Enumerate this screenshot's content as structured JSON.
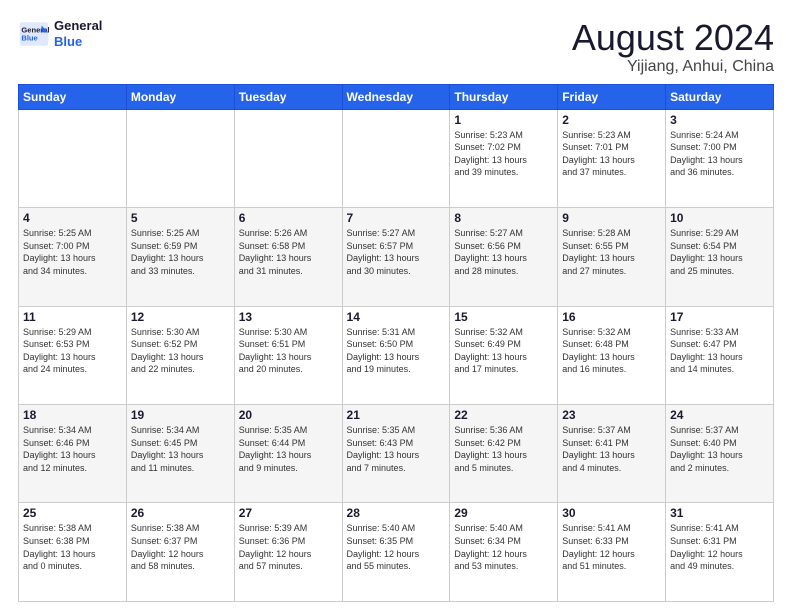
{
  "header": {
    "logo_line1": "General",
    "logo_line2": "Blue",
    "main_title": "August 2024",
    "subtitle": "Yijiang, Anhui, China"
  },
  "days_of_week": [
    "Sunday",
    "Monday",
    "Tuesday",
    "Wednesday",
    "Thursday",
    "Friday",
    "Saturday"
  ],
  "weeks": [
    [
      {
        "day": "",
        "info": ""
      },
      {
        "day": "",
        "info": ""
      },
      {
        "day": "",
        "info": ""
      },
      {
        "day": "",
        "info": ""
      },
      {
        "day": "1",
        "info": "Sunrise: 5:23 AM\nSunset: 7:02 PM\nDaylight: 13 hours\nand 39 minutes."
      },
      {
        "day": "2",
        "info": "Sunrise: 5:23 AM\nSunset: 7:01 PM\nDaylight: 13 hours\nand 37 minutes."
      },
      {
        "day": "3",
        "info": "Sunrise: 5:24 AM\nSunset: 7:00 PM\nDaylight: 13 hours\nand 36 minutes."
      }
    ],
    [
      {
        "day": "4",
        "info": "Sunrise: 5:25 AM\nSunset: 7:00 PM\nDaylight: 13 hours\nand 34 minutes."
      },
      {
        "day": "5",
        "info": "Sunrise: 5:25 AM\nSunset: 6:59 PM\nDaylight: 13 hours\nand 33 minutes."
      },
      {
        "day": "6",
        "info": "Sunrise: 5:26 AM\nSunset: 6:58 PM\nDaylight: 13 hours\nand 31 minutes."
      },
      {
        "day": "7",
        "info": "Sunrise: 5:27 AM\nSunset: 6:57 PM\nDaylight: 13 hours\nand 30 minutes."
      },
      {
        "day": "8",
        "info": "Sunrise: 5:27 AM\nSunset: 6:56 PM\nDaylight: 13 hours\nand 28 minutes."
      },
      {
        "day": "9",
        "info": "Sunrise: 5:28 AM\nSunset: 6:55 PM\nDaylight: 13 hours\nand 27 minutes."
      },
      {
        "day": "10",
        "info": "Sunrise: 5:29 AM\nSunset: 6:54 PM\nDaylight: 13 hours\nand 25 minutes."
      }
    ],
    [
      {
        "day": "11",
        "info": "Sunrise: 5:29 AM\nSunset: 6:53 PM\nDaylight: 13 hours\nand 24 minutes."
      },
      {
        "day": "12",
        "info": "Sunrise: 5:30 AM\nSunset: 6:52 PM\nDaylight: 13 hours\nand 22 minutes."
      },
      {
        "day": "13",
        "info": "Sunrise: 5:30 AM\nSunset: 6:51 PM\nDaylight: 13 hours\nand 20 minutes."
      },
      {
        "day": "14",
        "info": "Sunrise: 5:31 AM\nSunset: 6:50 PM\nDaylight: 13 hours\nand 19 minutes."
      },
      {
        "day": "15",
        "info": "Sunrise: 5:32 AM\nSunset: 6:49 PM\nDaylight: 13 hours\nand 17 minutes."
      },
      {
        "day": "16",
        "info": "Sunrise: 5:32 AM\nSunset: 6:48 PM\nDaylight: 13 hours\nand 16 minutes."
      },
      {
        "day": "17",
        "info": "Sunrise: 5:33 AM\nSunset: 6:47 PM\nDaylight: 13 hours\nand 14 minutes."
      }
    ],
    [
      {
        "day": "18",
        "info": "Sunrise: 5:34 AM\nSunset: 6:46 PM\nDaylight: 13 hours\nand 12 minutes."
      },
      {
        "day": "19",
        "info": "Sunrise: 5:34 AM\nSunset: 6:45 PM\nDaylight: 13 hours\nand 11 minutes."
      },
      {
        "day": "20",
        "info": "Sunrise: 5:35 AM\nSunset: 6:44 PM\nDaylight: 13 hours\nand 9 minutes."
      },
      {
        "day": "21",
        "info": "Sunrise: 5:35 AM\nSunset: 6:43 PM\nDaylight: 13 hours\nand 7 minutes."
      },
      {
        "day": "22",
        "info": "Sunrise: 5:36 AM\nSunset: 6:42 PM\nDaylight: 13 hours\nand 5 minutes."
      },
      {
        "day": "23",
        "info": "Sunrise: 5:37 AM\nSunset: 6:41 PM\nDaylight: 13 hours\nand 4 minutes."
      },
      {
        "day": "24",
        "info": "Sunrise: 5:37 AM\nSunset: 6:40 PM\nDaylight: 13 hours\nand 2 minutes."
      }
    ],
    [
      {
        "day": "25",
        "info": "Sunrise: 5:38 AM\nSunset: 6:38 PM\nDaylight: 13 hours\nand 0 minutes."
      },
      {
        "day": "26",
        "info": "Sunrise: 5:38 AM\nSunset: 6:37 PM\nDaylight: 12 hours\nand 58 minutes."
      },
      {
        "day": "27",
        "info": "Sunrise: 5:39 AM\nSunset: 6:36 PM\nDaylight: 12 hours\nand 57 minutes."
      },
      {
        "day": "28",
        "info": "Sunrise: 5:40 AM\nSunset: 6:35 PM\nDaylight: 12 hours\nand 55 minutes."
      },
      {
        "day": "29",
        "info": "Sunrise: 5:40 AM\nSunset: 6:34 PM\nDaylight: 12 hours\nand 53 minutes."
      },
      {
        "day": "30",
        "info": "Sunrise: 5:41 AM\nSunset: 6:33 PM\nDaylight: 12 hours\nand 51 minutes."
      },
      {
        "day": "31",
        "info": "Sunrise: 5:41 AM\nSunset: 6:31 PM\nDaylight: 12 hours\nand 49 minutes."
      }
    ]
  ]
}
